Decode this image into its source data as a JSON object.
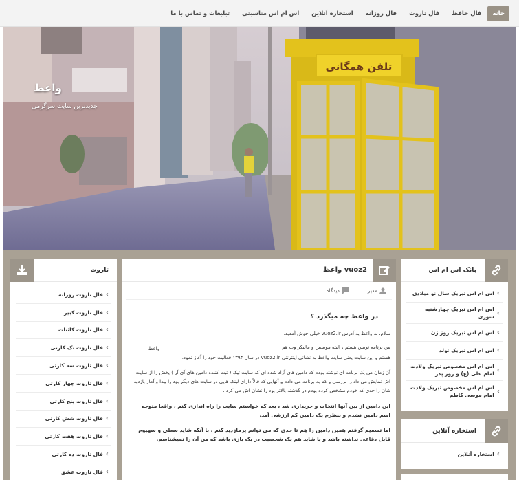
{
  "nav": {
    "items": [
      {
        "label": "خانه",
        "active": true
      },
      {
        "label": "فال حافظ"
      },
      {
        "label": "فال تاروت"
      },
      {
        "label": "فال روزانه"
      },
      {
        "label": "استخاره آنلاین"
      },
      {
        "label": "اس ام اس مناسبتی"
      },
      {
        "label": "تبلیغات و تماس با ما"
      }
    ]
  },
  "hero": {
    "site_title": "واعظ",
    "site_tagline": "جدیدترین سایت سرگرمی",
    "booth_sign": "تلفن همگانی"
  },
  "left_widget": {
    "title": "تاروت",
    "items": [
      "فال تاروت روزانه",
      "فال تاروت کبیر",
      "فال تاروت کائنات",
      "فال تاروت تک کارتی",
      "فال تاروت سه کارتی",
      "فال تاروت چهار کارتی",
      "فال تاروت پنج کارتی",
      "فال تاروت شش کارتی",
      "فال تاروت هفت کارتی",
      "فال تاروت ده کارتی",
      "فال تاروت عشق"
    ]
  },
  "post": {
    "title": "واعظ vuoz2",
    "meta_author": "مدیر",
    "meta_comments": "دیدگاه",
    "heading": "در واعظ چه میگذرد ؟",
    "inline_image_alt": "واعظ",
    "p1": "سلام، به واعظ به آدرس vuoz2.ir خیلی خوش آمدید.",
    "p2": "من برنامه نویس هستم ، البته موسس و مالیکر وب هم",
    "p3": "هستم و این سایت یعنی سایت واعظ به نشانی اینترنتی vuoz2.ir در سال ۱۳۹۴ فعالیت خود را آغاز نمود.",
    "p4": "آن زمان من یک برنامه ای نوشته بودم که دامین های آزاد شده ای که سایت تیک ( ثبت کننده دامین های آی آر ) پخش را از سایت اش نمایش می داد را بررسی و کم به برنامه می دادم و آنهایی که قالاً دارای لینک هایی در سایت های دیگر بود را پیدا و آمار بازدید شان را حدی که خودم مشخص کرده بودم در گذشته بالاتر بود را نشان اش می کرد .",
    "p5": "این دامین از بین آنها انتخاب و خریداری شد ، بعد که خواستم سایت را راه اندازی کنم ، واقعا متوجه اسم دامین نشدم و بنظرم یک دامین کم ارزشی آمد.",
    "p6": "اما تسمیم گرفتم همین دامین را هم تا حدی که می توانم پرمازدید کنم ، با آنکه شاید سطی و سهیوم قابل دفاعی نداشته باشد و یا شاید هم یک شخصیت در یک بازی باشد که من آن را نمیشناسم."
  },
  "right_widget": {
    "title": "بانک اس ام اس",
    "items": [
      "اس ام اس تبریک سال نو میلادی",
      "اس ام اس تبریک چهارشنبه سوری",
      "اس ام اس تبریک روز زن",
      "اس ام اس تبریک تولد",
      "اس ام اس مخصوص تبریک ولادت امام علی (ع) و روز پدر",
      "اس ام اس مخصوص تبریک ولادت امام موسی کاظم"
    ]
  },
  "right_widget2": {
    "title": "استخاره آنلاین",
    "items": [
      "استخاره آنلاین"
    ]
  },
  "colors": {
    "accent": "#9c958a",
    "band": "#a9a194",
    "booth": "#e3c21c"
  }
}
